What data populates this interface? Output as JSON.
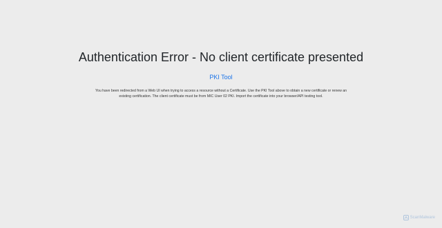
{
  "page": {
    "title": "Authentication Error - No client certificate presented",
    "link_label": "PKI Tool",
    "description": "You have been redirected from a Web UI when trying to access a resource without a Certificate. Use the PKI Tool above to obtain a new certificate or renew an existing certification. The client certificate must be from MIC User 02 PKI. Import the certificate into your browser/API testing tool."
  },
  "watermark": {
    "label": "ScanMalware",
    "icon": "scanmalware-logo-icon"
  },
  "colors": {
    "background": "#ececec",
    "link": "#1a73e8",
    "text": "#212529"
  }
}
